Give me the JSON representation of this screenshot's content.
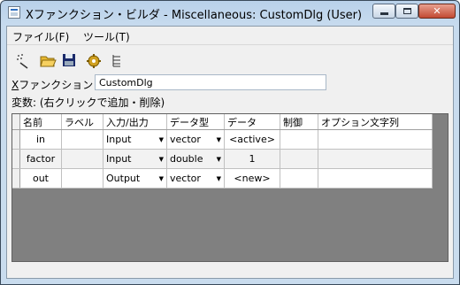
{
  "window": {
    "title": "Xファンクション・ビルダ - Miscellaneous: CustomDlg (User)"
  },
  "menu": {
    "file": "ファイル(F)",
    "tools": "ツール(T)"
  },
  "toolbar": {
    "icons": [
      "wand-icon",
      "open-folder-icon",
      "save-icon",
      "gear-icon",
      "tree-icon"
    ]
  },
  "xfunction": {
    "label_prefix": "X",
    "label_rest": "ファンクション",
    "value": "CustomDlg"
  },
  "variables": {
    "hint": "変数: (右クリックで追加・削除)"
  },
  "grid": {
    "headers": [
      "名前",
      "ラベル",
      "入力/出力",
      "データ型",
      "データ",
      "制御",
      "オプション文字列"
    ],
    "rows": [
      {
        "name": "in",
        "label": "",
        "io": "Input",
        "type": "vector",
        "data": "<active>",
        "control": "",
        "options": ""
      },
      {
        "name": "factor",
        "label": "",
        "io": "Input",
        "type": "double",
        "data": "1",
        "control": "",
        "options": ""
      },
      {
        "name": "out",
        "label": "",
        "io": "Output",
        "type": "vector",
        "data": "<new>",
        "control": "",
        "options": ""
      }
    ]
  }
}
